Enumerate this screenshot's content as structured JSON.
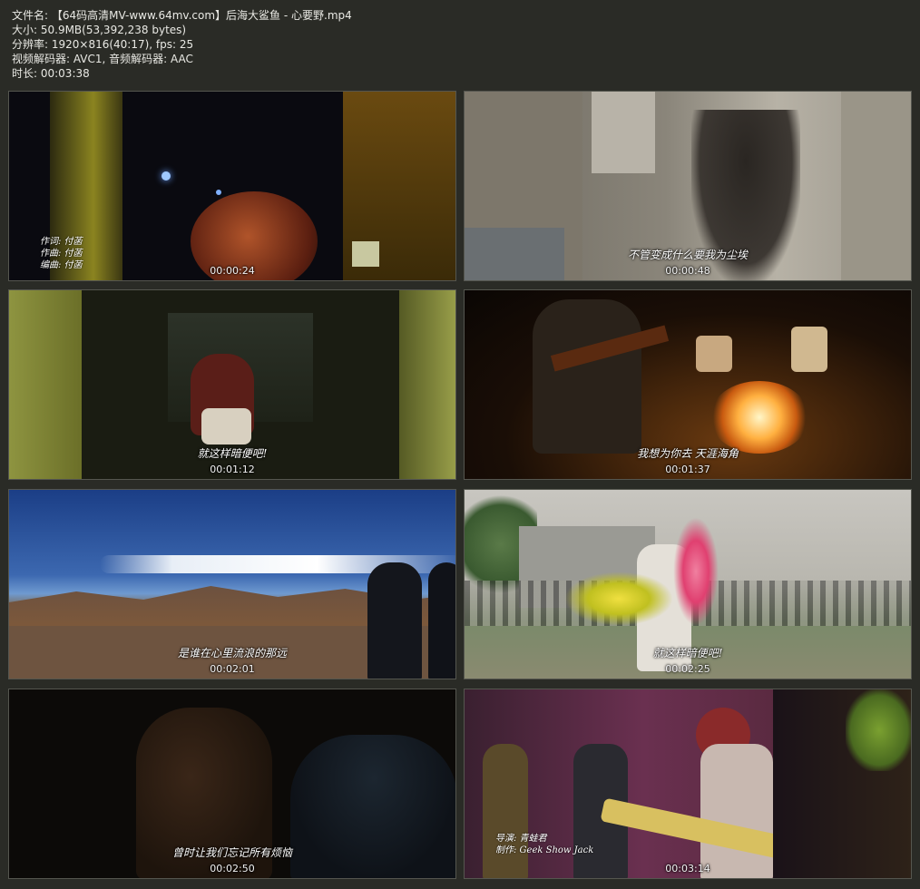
{
  "info": {
    "filename": "文件名: 【64码高清MV-www.64mv.com】后海大鲨鱼 - 心要野.mp4",
    "size": "大小: 50.9MB(53,392,238 bytes)",
    "resolution": "分辨率: 1920×816(40:17), fps: 25",
    "codecs": "视频解码器: AVC1, 音频解码器: AAC",
    "duration": "时长: 00:03:38"
  },
  "thumbnails": [
    {
      "timestamp": "00:00:24",
      "subtitle": "",
      "credits": [
        "作词: 付菡",
        "作曲: 付菡",
        "编曲: 付菡"
      ]
    },
    {
      "timestamp": "00:00:48",
      "subtitle": "不管变成什么要我为尘埃",
      "credits": []
    },
    {
      "timestamp": "00:01:12",
      "subtitle": "就这样暗便吧!",
      "credits": []
    },
    {
      "timestamp": "00:01:37",
      "subtitle": "我想为你去 天涯海角",
      "credits": []
    },
    {
      "timestamp": "00:02:01",
      "subtitle": "是谁在心里流浪的那远",
      "credits": []
    },
    {
      "timestamp": "00:02:25",
      "subtitle": "就这样暗便吧!",
      "credits": []
    },
    {
      "timestamp": "00:02:50",
      "subtitle": "曾时让我们忘记所有烦恼",
      "credits": []
    },
    {
      "timestamp": "00:03:14",
      "subtitle": "",
      "credits": [
        "导演: 青蛙君",
        "制作: Geek Show Jack"
      ]
    }
  ],
  "colors": {
    "background": "#2a2b26",
    "text": "#e9e9e4",
    "border": "#55564f"
  }
}
